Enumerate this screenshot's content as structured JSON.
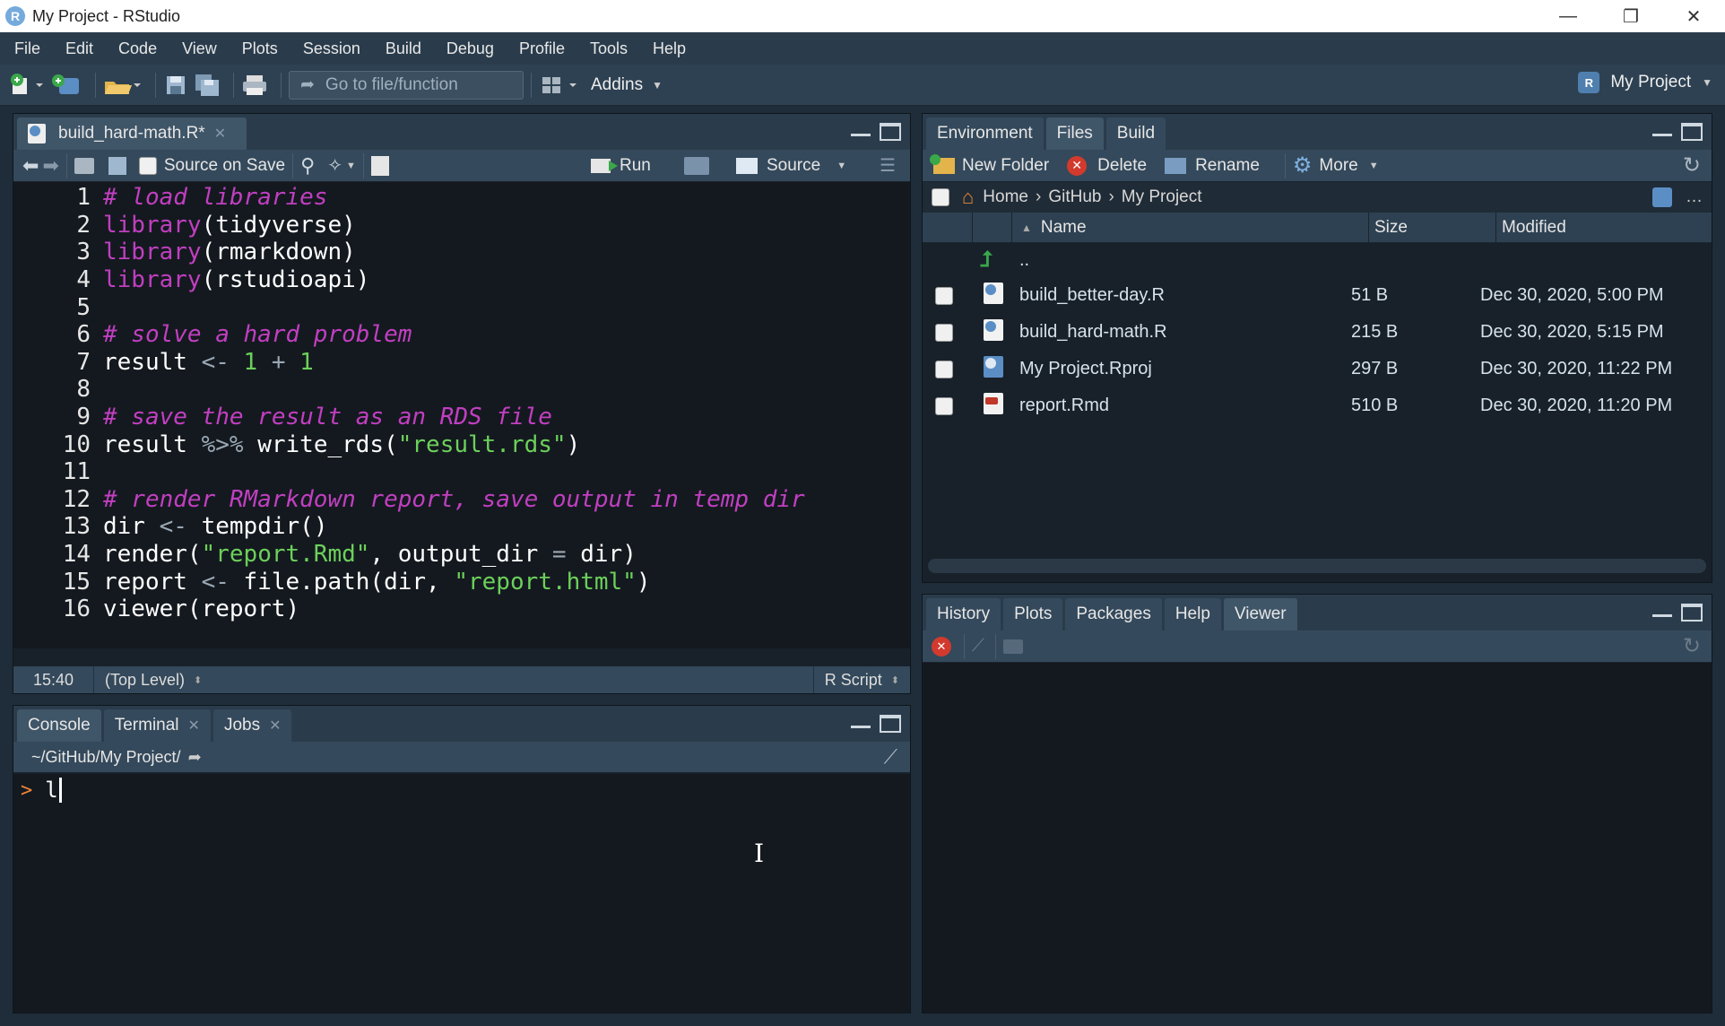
{
  "window": {
    "title": "My Project - RStudio",
    "app_icon_letter": "R",
    "controls": {
      "minimize": "—",
      "restore": "❐",
      "close": "✕"
    }
  },
  "menu": [
    "File",
    "Edit",
    "Code",
    "View",
    "Plots",
    "Session",
    "Build",
    "Debug",
    "Profile",
    "Tools",
    "Help"
  ],
  "toolbar": {
    "goto_placeholder": "Go to file/function",
    "addins_label": "Addins",
    "project_label": "My Project"
  },
  "editor": {
    "tab_label": "build_hard-math.R*",
    "source_on_save": "Source on Save",
    "run_label": "Run",
    "source_label": "Source",
    "status": {
      "position": "15:40",
      "scope": "(Top Level)",
      "filetype": "R Script"
    }
  },
  "console": {
    "tabs": [
      "Console",
      "Terminal",
      "Jobs"
    ],
    "path": "~/GitHub/My Project/",
    "prompt": ">",
    "input": "l"
  },
  "top_right": {
    "tabs": [
      "Environment",
      "Files",
      "Build"
    ],
    "actions": {
      "new_folder": "New Folder",
      "delete": "Delete",
      "rename": "Rename",
      "more": "More"
    },
    "breadcrumb": [
      "Home",
      "GitHub",
      "My Project"
    ],
    "columns": {
      "name": "Name",
      "size": "Size",
      "modified": "Modified"
    },
    "parent_dir": "..",
    "files": [
      {
        "name": "build_better-day.R",
        "size": "51 B",
        "modified": "Dec 30, 2020, 5:00 PM",
        "icon": "r-file"
      },
      {
        "name": "build_hard-math.R",
        "size": "215 B",
        "modified": "Dec 30, 2020, 5:15 PM",
        "icon": "r-file"
      },
      {
        "name": "My Project.Rproj",
        "size": "297 B",
        "modified": "Dec 30, 2020, 11:22 PM",
        "icon": "rproj-file"
      },
      {
        "name": "report.Rmd",
        "size": "510 B",
        "modified": "Dec 30, 2020, 11:20 PM",
        "icon": "rmd-file"
      }
    ]
  },
  "bottom_right": {
    "tabs": [
      "History",
      "Plots",
      "Packages",
      "Help",
      "Viewer"
    ]
  }
}
